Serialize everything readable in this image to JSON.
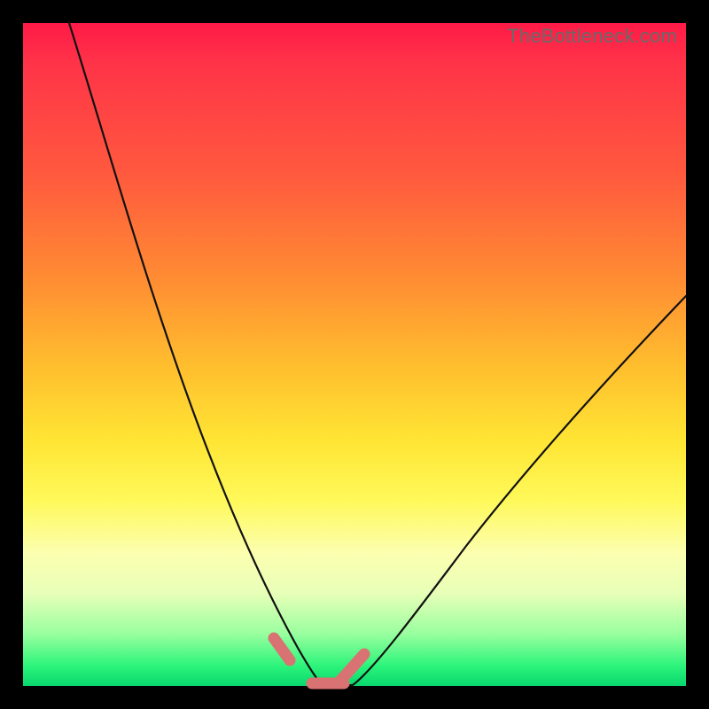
{
  "watermark": "TheBottleneck.com",
  "colors": {
    "background": "#000000",
    "gradient_top": "#ff1a47",
    "gradient_mid": "#ffe534",
    "gradient_bottom": "#08d76e",
    "curve": "#111111",
    "marker": "#d97273"
  },
  "chart_data": {
    "type": "line",
    "title": "",
    "xlabel": "",
    "ylabel": "",
    "xlim": [
      0,
      100
    ],
    "ylim": [
      0,
      100
    ],
    "grid": false,
    "series": [
      {
        "name": "left-curve",
        "x": [
          7,
          12,
          17,
          22,
          27,
          31,
          35,
          38,
          40,
          42,
          44
        ],
        "y": [
          100,
          82,
          65,
          49,
          34,
          22,
          12,
          6,
          3,
          1,
          0
        ]
      },
      {
        "name": "valley-floor",
        "x": [
          44,
          46,
          48,
          50
        ],
        "y": [
          0,
          0,
          0,
          0
        ]
      },
      {
        "name": "right-curve",
        "x": [
          50,
          55,
          62,
          70,
          80,
          90,
          100
        ],
        "y": [
          0,
          6,
          15,
          26,
          38,
          49,
          59
        ]
      }
    ],
    "markers": [
      {
        "name": "left-dash",
        "x": [
          37.5,
          40.0
        ],
        "y": [
          7.0,
          3.0
        ]
      },
      {
        "name": "right-dash1",
        "x": [
          43.5,
          48.5
        ],
        "y": [
          0.3,
          0.3
        ]
      },
      {
        "name": "right-dash2",
        "x": [
          48.0,
          51.5
        ],
        "y": [
          0.8,
          4.5
        ]
      }
    ],
    "annotations": []
  }
}
